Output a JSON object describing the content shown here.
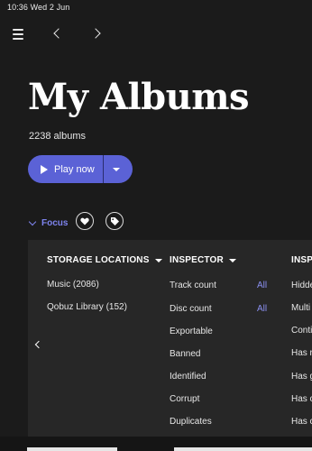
{
  "status": {
    "text": "10:36  Wed 2 Jun"
  },
  "nav": {
    "menu_icon": "hamburger-icon",
    "back_icon": "chevron-left-icon",
    "forward_icon": "chevron-right-icon"
  },
  "header": {
    "title": "My Albums",
    "subtitle": "2238 albums"
  },
  "actions": {
    "play_label": "Play now",
    "play_icon": "play-icon",
    "dropdown_icon": "caret-down-icon",
    "accent": "#5b62d6"
  },
  "focus": {
    "label": "Focus",
    "accent": "#7e84ee",
    "heart_icon": "heart-icon",
    "tag_icon": "tag-icon"
  },
  "panel": {
    "storage": {
      "header": "STORAGE LOCATIONS",
      "items": [
        "Music (2086)",
        "Qobuz Library (152)"
      ]
    },
    "inspector": {
      "header": "INSPECTOR",
      "items": [
        "Track count",
        "Disc count",
        "Exportable",
        "Banned",
        "Identified",
        "Corrupt",
        "Duplicates"
      ],
      "all_label": "All"
    },
    "third": {
      "header": "INSP",
      "items": [
        "Hidde",
        "Multi",
        "Conti",
        "Has r",
        "Has g",
        "Has c",
        "Has c"
      ]
    }
  }
}
